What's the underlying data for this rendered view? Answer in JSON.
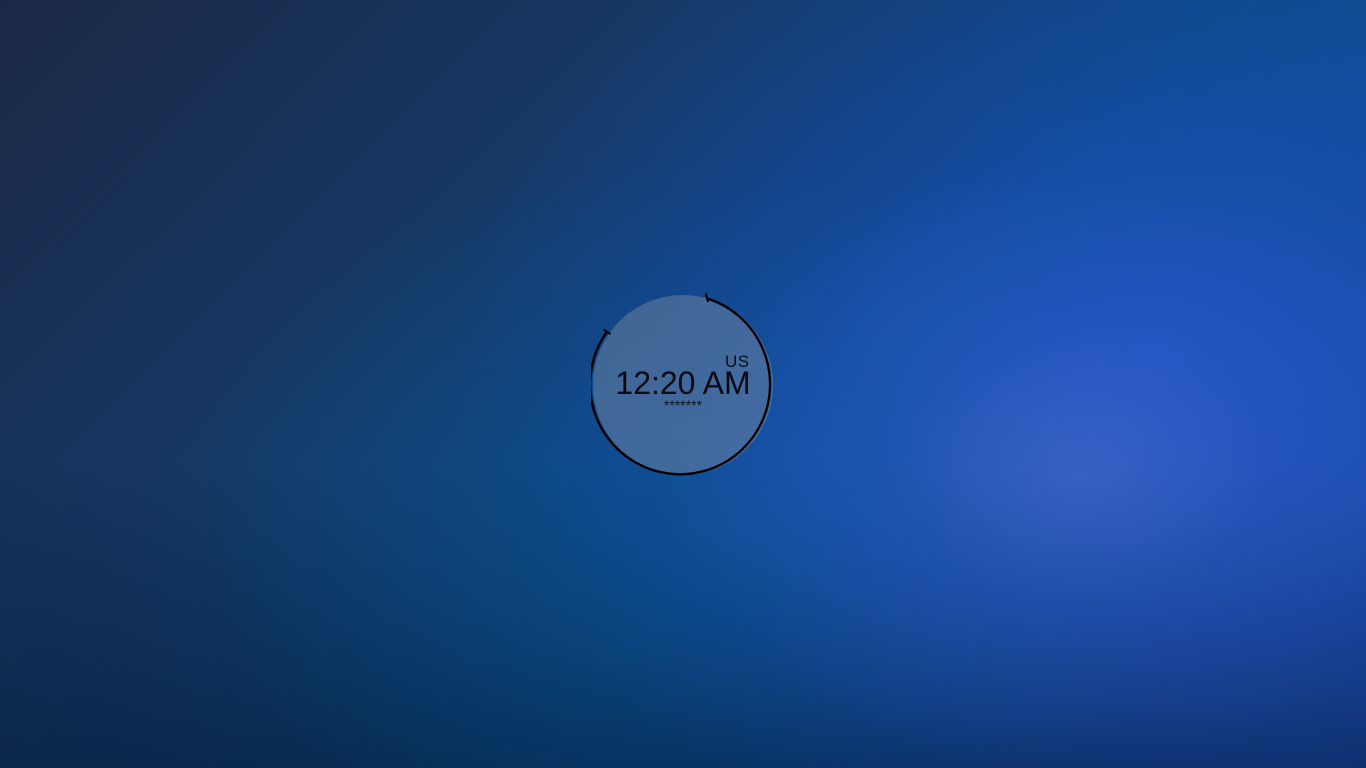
{
  "greeter": {
    "keyboard_layout": "US",
    "clock_text": "12:20 AM",
    "password_masked": "*******"
  },
  "colors": {
    "ring": "#000000",
    "disc_fill": "#5f7a99",
    "text": "#060a12"
  }
}
